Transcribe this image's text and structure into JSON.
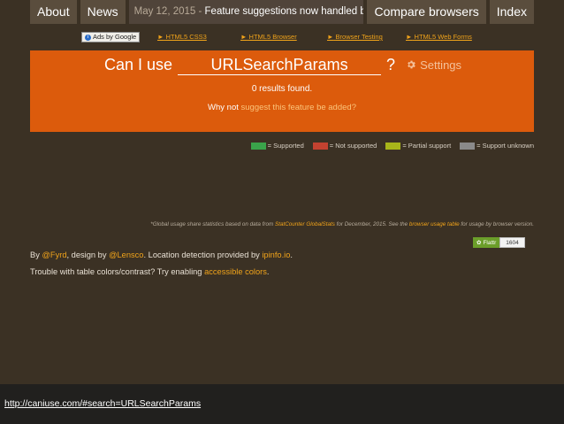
{
  "nav": {
    "about": "About",
    "news": "News",
    "news_date": "May 12, 2015 -",
    "news_text": "Feature suggestions now handled by …",
    "compare": "Compare browsers",
    "index": "Index"
  },
  "ads": {
    "badge": "Ads by Google",
    "links": [
      "HTML5 CSS3",
      "HTML5 Browser",
      "Browser Testing",
      "HTML5 Web Forms"
    ],
    "arrow": "►"
  },
  "search": {
    "prefix": "Can I use",
    "query": "URLSearchParams",
    "suffix": "?",
    "settings": "Settings",
    "results": "0 results found.",
    "why_prefix": "Why not",
    "why_link": "suggest this feature be added?"
  },
  "legend": [
    {
      "label": "= Supported",
      "color": "#3aa34a"
    },
    {
      "label": "= Not supported",
      "color": "#c44230"
    },
    {
      "label": "= Partial support",
      "color": "#a8b51a"
    },
    {
      "label": "= Support unknown",
      "color": "#8a8a8a"
    }
  ],
  "footnote": {
    "p1": "*Global usage share statistics based on data from",
    "link1": "StatCounter GlobalStats",
    "p2": "for December, 2015. See the",
    "link2": "browser usage table",
    "p3": "for usage by browser version."
  },
  "credits": {
    "by": "By",
    "fyrd": "@Fyrd",
    "design": ", design by",
    "lensco": "@Lensco",
    "location": ". Location detection provided by",
    "ipinfo": "ipinfo.io",
    "end": ".",
    "trouble": "Trouble with table colors/contrast? Try enabling",
    "accessible": "accessible colors",
    "end2": "."
  },
  "flattr": {
    "label": "Flattr",
    "count": "1604"
  },
  "url": "http://caniuse.com/#search=URLSearchParams"
}
